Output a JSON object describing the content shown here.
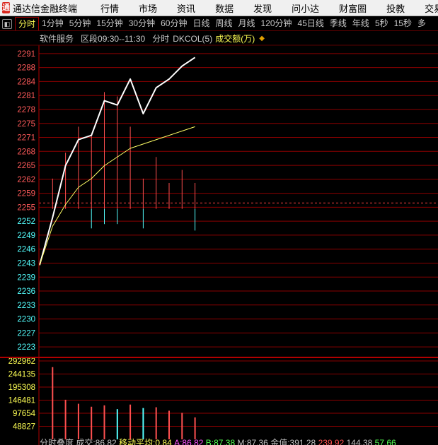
{
  "app": {
    "logo_glyph": "通",
    "title": "通达信金融终端"
  },
  "menu": [
    "行情",
    "市场",
    "资讯",
    "数据",
    "发现",
    "问小达",
    "财富圈",
    "投教",
    "交易"
  ],
  "tabs": {
    "toggle": "◧",
    "items": [
      "分时",
      "1分钟",
      "5分钟",
      "15分钟",
      "30分钟",
      "60分钟",
      "日线",
      "周线",
      "月线",
      "120分钟",
      "45日线",
      "季线",
      "年线",
      "5秒",
      "15秒",
      "多"
    ],
    "active_index": 0
  },
  "info": {
    "symbol": "软件服务",
    "session": "区段09:30--11:30",
    "mode": "分时",
    "indicator": "DKCOL(5)",
    "volume_label": "成交额(万)",
    "arrow": "◆"
  },
  "colors": {
    "background": "#000000",
    "grid": "#8b0000",
    "price_line": "#ffffff",
    "avg_line": "#ffff66",
    "up": "#ff5050",
    "down": "#54ffff",
    "ref_line": "#ff4040",
    "up_axis_text": "#ff5a5a",
    "down_axis_text": "#54ffff",
    "vol_axis_text": "#ffff54"
  },
  "chart_data": [
    {
      "type": "line",
      "title": "",
      "reference_price": 2255,
      "y_ticks": [
        "2291",
        "2288",
        "2284",
        "2281",
        "2278",
        "2275",
        "2271",
        "2268",
        "2265",
        "2262",
        "2259",
        "2255",
        "2252",
        "2249",
        "2246",
        "2243",
        "2239",
        "2236",
        "2233",
        "2230",
        "2227",
        "2223"
      ],
      "ylim": [
        2221.5,
        2292.5
      ],
      "series": [
        {
          "values": [
            2242,
            2253,
            2265,
            2271,
            2272,
            2280,
            2279,
            2285,
            2277,
            2283,
            2285,
            2288,
            2290
          ]
        },
        {
          "values": [
            2242,
            2251,
            2256,
            2260,
            2262,
            2265,
            2267,
            2269,
            2270,
            2271,
            2272,
            2273,
            2274
          ]
        }
      ],
      "x": [
        0,
        1,
        2,
        3,
        4,
        5,
        6,
        7,
        8,
        9,
        10,
        11,
        12
      ],
      "bars": [
        {
          "x": 1,
          "high": 2262,
          "low": 2255
        },
        {
          "x": 2,
          "high": 2268,
          "low": 2255
        },
        {
          "x": 3,
          "high": 2274,
          "low": 2255
        },
        {
          "x": 4,
          "high": 2272,
          "low": 2250.5
        },
        {
          "x": 5,
          "high": 2282,
          "low": 2251.5
        },
        {
          "x": 6,
          "high": 2281,
          "low": 2251.5
        },
        {
          "x": 7,
          "high": 2274,
          "low": 2255
        },
        {
          "x": 8,
          "high": 2262,
          "low": 2250.5
        },
        {
          "x": 9,
          "high": 2267,
          "low": 2255
        },
        {
          "x": 10,
          "high": 2261,
          "low": 2255
        },
        {
          "x": 11,
          "high": 2264,
          "low": 2255
        },
        {
          "x": 12,
          "high": 2261,
          "low": 2250
        }
      ]
    },
    {
      "type": "bar",
      "title": "",
      "y_ticks": [
        "292962",
        "244135",
        "195308",
        "146481",
        "97654",
        "48827"
      ],
      "ylim": [
        0,
        292962
      ],
      "x": [
        1,
        2,
        3,
        4,
        5,
        6,
        7,
        8,
        9,
        10,
        11,
        12
      ],
      "values": [
        270000,
        148000,
        133000,
        122000,
        127000,
        113000,
        130000,
        117000,
        120000,
        107000,
        99000,
        82000
      ],
      "directions": [
        "up",
        "up",
        "up",
        "up",
        "up",
        "down",
        "up",
        "down",
        "up",
        "up",
        "up",
        "up"
      ]
    }
  ],
  "status": {
    "segments": [
      {
        "text": "分时叠度",
        "color": "#c0c0c0"
      },
      {
        "text": " 成交:86.82",
        "color": "#c0c0c0"
      },
      {
        "text": " 移动平均:0.84",
        "color": "#ffff54"
      },
      {
        "text": " A:86.82",
        "color": "#ff54ff"
      },
      {
        "text": " B:87.38",
        "color": "#54ff54"
      },
      {
        "text": " M:87.36",
        "color": "#c0c0c0"
      },
      {
        "text": " 金值:391.28",
        "color": "#c0c0c0"
      },
      {
        "text": " 239.92",
        "color": "#ff5050"
      },
      {
        "text": " 144.38",
        "color": "#c0c0c0"
      },
      {
        "text": " 57.66",
        "color": "#54ff54"
      }
    ]
  }
}
